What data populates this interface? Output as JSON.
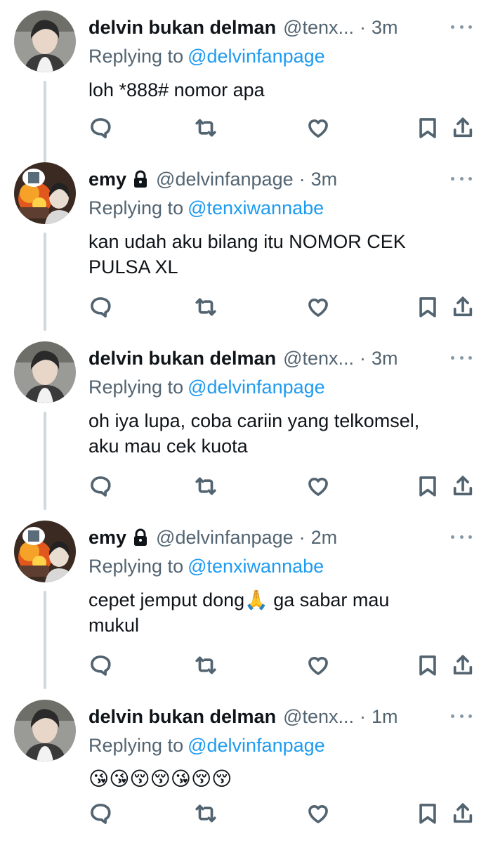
{
  "tweets": [
    {
      "name": "delvin bukan delman",
      "locked": false,
      "handle": "@tenx...",
      "time": "3m",
      "replying_label": "Replying to",
      "replying_to": "@delvinfanpage",
      "text": "loh *888# nomor apa",
      "avatar": "portrait"
    },
    {
      "name": "emy",
      "locked": true,
      "handle": "@delvinfanpage",
      "time": "3m",
      "replying_label": "Replying to",
      "replying_to": "@tenxiwannabe",
      "text": "kan udah aku bilang itu NOMOR CEK\nPULSA XL",
      "avatar": "fire"
    },
    {
      "name": "delvin bukan delman",
      "locked": false,
      "handle": "@tenx...",
      "time": "3m",
      "replying_label": "Replying to",
      "replying_to": "@delvinfanpage",
      "text": "oh iya lupa, coba cariin yang telkomsel,\naku mau cek kuota",
      "avatar": "portrait"
    },
    {
      "name": "emy",
      "locked": true,
      "handle": "@delvinfanpage",
      "time": "2m",
      "replying_label": "Replying to",
      "replying_to": "@tenxiwannabe",
      "text": "cepet jemput dong🙏 ga sabar mau\nmukul",
      "avatar": "fire"
    },
    {
      "name": "delvin bukan delman",
      "locked": false,
      "handle": "@tenx...",
      "time": "1m",
      "replying_label": "Replying to",
      "replying_to": "@delvinfanpage",
      "text": "😘😘😚😚😘😚😚",
      "avatar": "portrait"
    }
  ],
  "icons": [
    "reply-icon",
    "retweet-icon",
    "like-icon",
    "bookmark-icon",
    "share-icon",
    "more-icon",
    "lock-icon"
  ],
  "colors": {
    "link": "#1d9bf0",
    "secondary": "#536471",
    "line": "#cfd9de"
  }
}
